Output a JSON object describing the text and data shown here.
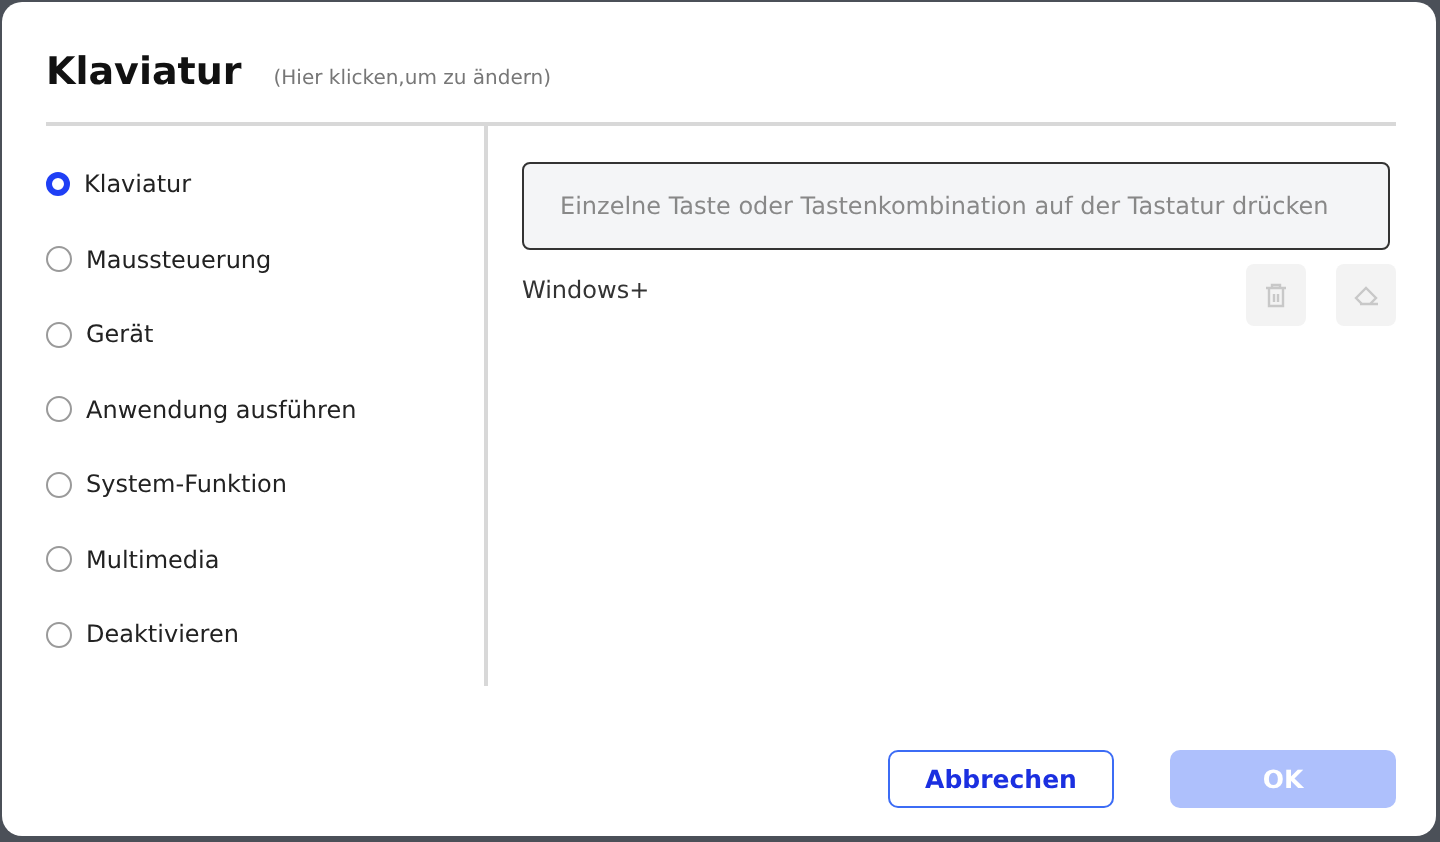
{
  "dialog": {
    "title": "Klaviatur",
    "hint": "(Hier klicken,um zu ändern)"
  },
  "options": [
    {
      "label": "Klaviatur",
      "selected": true
    },
    {
      "label": "Maussteuerung",
      "selected": false
    },
    {
      "label": "Gerät",
      "selected": false
    },
    {
      "label": "Anwendung ausführen",
      "selected": false
    },
    {
      "label": "System-Funktion",
      "selected": false
    },
    {
      "label": "Multimedia",
      "selected": false
    },
    {
      "label": "Deaktivieren",
      "selected": false
    }
  ],
  "key_field": {
    "placeholder": "Einzelne Taste oder Tastenkombination auf der Tastatur drücken"
  },
  "combo_text": "Windows+",
  "tools": [
    {
      "kind": "delete",
      "disabled": true
    },
    {
      "kind": "erase",
      "disabled": true
    }
  ],
  "buttons": [
    {
      "label": "Abbrechen",
      "kind": "secondary",
      "disabled": false
    },
    {
      "label": "OK",
      "kind": "primary",
      "disabled": true
    }
  ]
}
